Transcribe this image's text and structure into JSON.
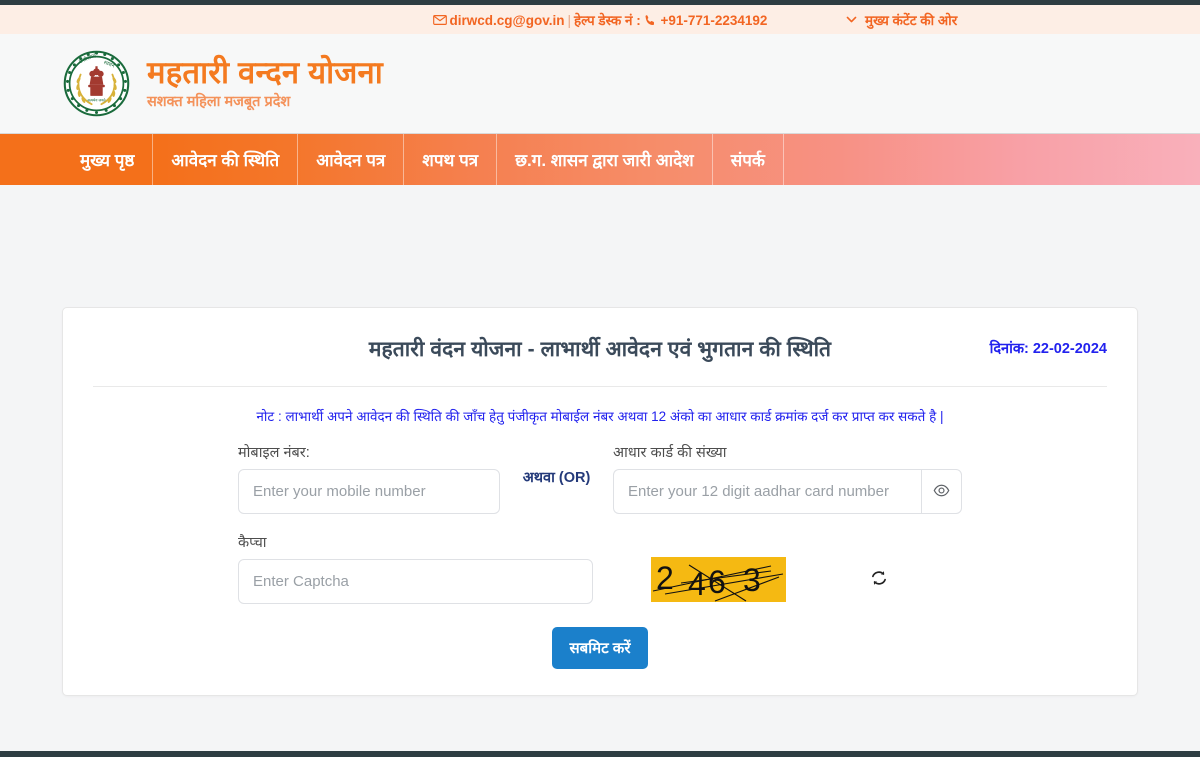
{
  "topbar": {
    "email": "dirwcd.cg@gov.in",
    "separator": "|",
    "helpdesk_label": "हेल्प डेस्क नं :",
    "phone": "+91-771-2234192",
    "skip_link": "मुख्य कंटेंट की ओर",
    "mail_icon": "mail-icon",
    "phone_icon": "phone-icon",
    "chevron_icon": "chevron-down-icon",
    "accent_color": "#f26522",
    "background": "#fdeee5"
  },
  "brand": {
    "emblem_icon": "chhattisgarh-government-emblem",
    "emblem_ring_text": "छत्तीसगढ़ शासन",
    "title": "महतारी वन्दन योजना",
    "subtitle": "सशक्त महिला मजबूत प्रदेश",
    "title_color": "#f47a20"
  },
  "nav": {
    "items": [
      {
        "label": "मुख्य पृष्ठ"
      },
      {
        "label": "आवेदन की स्थिति"
      },
      {
        "label": "आवेदन पत्र"
      },
      {
        "label": "शपथ पत्र"
      },
      {
        "label": "छ.ग. शासन द्वारा जारी आदेश"
      },
      {
        "label": "संपर्क"
      }
    ],
    "gradient_start": "#f4701a",
    "gradient_end": "#f9b0bb"
  },
  "card": {
    "title": "महतारी वंदन योजना - लाभार्थी आवेदन एवं भुगतान की स्थिति",
    "date_label": "दिनांक: 22-02-2024",
    "date_color": "#2222ee",
    "note": "नोट : लाभार्थी अपने आवेदन की स्थिति की जाँच हेतु पंजीकृत मोबाईल नंबर अथवा 12 अंको का आधार कार्ड क्रमांक दर्ज कर प्राप्त कर सकते है |"
  },
  "form": {
    "mobile": {
      "label": "मोबाइल नंबर:",
      "placeholder": "Enter your mobile number",
      "value": ""
    },
    "or_text": "अथवा (OR)",
    "aadhar": {
      "label": "आधार कार्ड की संख्या",
      "placeholder": "Enter your 12 digit aadhar card number",
      "value": "",
      "toggle_icon": "eye-icon"
    },
    "captcha": {
      "label": "कैप्चा",
      "placeholder": "Enter Captcha",
      "value": "",
      "image_text": "2463",
      "image_background": "#f5b912",
      "refresh_icon": "refresh-icon"
    },
    "submit_label": "सबमिट करें",
    "submit_color": "#1b80cb"
  }
}
